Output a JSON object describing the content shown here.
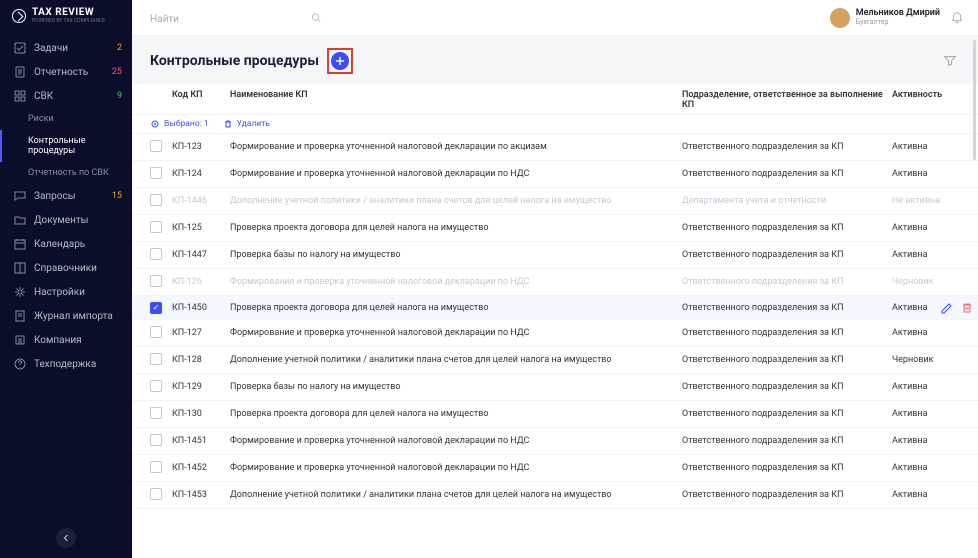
{
  "brand": {
    "name": "TAX REVIEW",
    "tagline": "POWERED BY TAX COMPLIANCE"
  },
  "sidebar": {
    "items": [
      {
        "icon": "check",
        "label": "Задачи",
        "badge": "2",
        "badgeClass": "badge"
      },
      {
        "icon": "doc",
        "label": "Отчетность",
        "badge": "25",
        "badgeClass": "badge red"
      },
      {
        "icon": "grid",
        "label": "СВК",
        "badge": "9",
        "badgeClass": "badge grn"
      },
      {
        "sub": true,
        "label": "Риски"
      },
      {
        "sub": true,
        "label": "Контрольные процедуры",
        "active": true
      },
      {
        "sub": true,
        "label": "Отчетность по СВК"
      },
      {
        "icon": "chat",
        "label": "Запросы",
        "badge": "15",
        "badgeClass": "badge"
      },
      {
        "icon": "folder",
        "label": "Документы"
      },
      {
        "icon": "cal",
        "label": "Календарь"
      },
      {
        "icon": "book",
        "label": "Справочники"
      },
      {
        "icon": "gear",
        "label": "Настройки"
      },
      {
        "icon": "journal",
        "label": "Журнал импорта"
      },
      {
        "icon": "comp",
        "label": "Компания"
      },
      {
        "icon": "help",
        "label": "Техподержка"
      }
    ]
  },
  "search": {
    "placeholder": "Найти"
  },
  "user": {
    "name": "Мельников Дмирий",
    "role": "Бухгалтер"
  },
  "page": {
    "title": "Контрольные процедуры"
  },
  "columns": {
    "code": "Код КП",
    "name": "Наименование КП",
    "dept": "Подразделение, ответственное за выполнение КП",
    "activity": "Активность"
  },
  "bulk": {
    "selected": "Выбрано: 1",
    "delete": "Удалить"
  },
  "rows": [
    {
      "code": "КП-123",
      "name": "Формирование и проверка уточненной налоговой декларации по акцизам",
      "dept": "Ответственного подразделения за КП",
      "act": "Активна"
    },
    {
      "code": "КП-124",
      "name": "Формирование и проверка уточненной налоговой декларации по НДС",
      "dept": "Ответственного подразделения за КП",
      "act": "Активна"
    },
    {
      "code": "КП-1446",
      "name": "Дополнение учетной политики / аналитики плана счетов для целей налога на имущество",
      "dept": "Департамента учета и отчетности",
      "act": "Не активна",
      "muted": true
    },
    {
      "code": "КП-125",
      "name": "Проверка проекта договора для целей налога на имущество",
      "dept": "Ответственного подразделения за КП",
      "act": "Активна"
    },
    {
      "code": "КП-1447",
      "name": "Проверка базы по налогу на имущество",
      "dept": "Ответственного подразделения за КП",
      "act": "Активна"
    },
    {
      "code": "КП-126",
      "name": "Формирование и проверка уточненной налоговой декларации по НДС",
      "dept": "Ответственного подразделения за КП",
      "act": "Черновик",
      "muted": true
    },
    {
      "code": "КП-1450",
      "name": "Проверка проекта договора для целей налога на имущество",
      "dept": "Ответственного подразделения за КП",
      "act": "Активна",
      "checked": true,
      "sel": true,
      "actions": true
    },
    {
      "code": "КП-127",
      "name": "Формирование и проверка уточненной налоговой декларации по НДС",
      "dept": "Ответственного подразделения за КП",
      "act": "Активна"
    },
    {
      "code": "КП-128",
      "name": "Дополнение учетной политики / аналитики плана счетов для целей налога на имущество",
      "dept": "Ответственного подразделения за КП",
      "act": "Черновик"
    },
    {
      "code": "КП-129",
      "name": "Проверка базы по налогу на имущество",
      "dept": "Ответственного подразделения за КП",
      "act": "Активна"
    },
    {
      "code": "КП-130",
      "name": "Проверка проекта договора для целей налога на имущество",
      "dept": "Ответственного подразделения за КП",
      "act": "Активна"
    },
    {
      "code": "КП-1451",
      "name": "Формирование и проверка уточненной налоговой декларации по НДС",
      "dept": "Ответственного подразделения за КП",
      "act": "Активна"
    },
    {
      "code": "КП-1452",
      "name": "Формирование и проверка уточненной налоговой декларации по НДС",
      "dept": "Ответственного подразделения за КП",
      "act": "Активна"
    },
    {
      "code": "КП-1453",
      "name": "Дополнение учетной политики / аналитики плана счетов для целей налога на имущество",
      "dept": "Ответственного подразделения за КП",
      "act": "Активна"
    }
  ]
}
